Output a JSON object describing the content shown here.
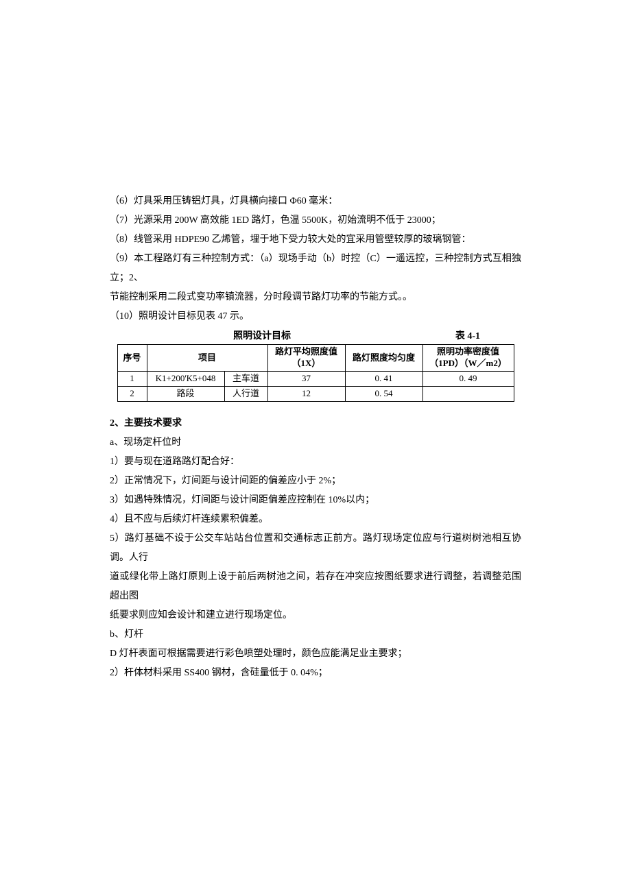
{
  "paras": {
    "p6": "（6）灯具采用压铸铝灯具，灯具横向接口 Φ60 毫米：",
    "p7": "（7）光源采用 200W 高效能 1ED 路灯，色温 5500K，初始流明不低于 23000；",
    "p8": "（8）线管采用 HDPE90 乙烯管，埋于地下受力较大处的宜采用管壁较厚的玻璃钢管：",
    "p9_1": "（9）本工程路灯有三种控制方式：（a）现场手动（b）时控（C）一遥远控，三种控制方式互相独立；2、",
    "p9_2": "节能控制采用二段式变功率镇流器，分时段调节路灯功率的节能方式。。",
    "p10": "（10）照明设计目标见表 47 示。"
  },
  "table": {
    "title": "照明设计目标",
    "number": "表 4-1",
    "headers": {
      "seq": "序号",
      "project": "项目",
      "avg_label": "路灯平均照度值",
      "avg_unit": "（1X）",
      "uniformity": "路灯照度均匀度",
      "power_label": "照明功率密度值",
      "power_unit": "（1PD）（W／m2）"
    },
    "rows": [
      {
        "seq": "1",
        "proj_a": "K1+200'K5+048",
        "proj_b": "主车道",
        "avg": "37",
        "uni": "0. 41",
        "pow": "0. 49"
      },
      {
        "seq": "2",
        "proj_a": "路段",
        "proj_b": "人行道",
        "avg": "12",
        "uni": "0. 54",
        "pow": ""
      }
    ]
  },
  "chart_data": {
    "type": "table",
    "title": "照明设计目标",
    "columns": [
      "序号",
      "项目",
      "",
      "路灯平均照度值（1X）",
      "路灯照度均匀度",
      "照明功率密度值（1PD）（W／m2）"
    ],
    "rows": [
      [
        "1",
        "K1+200'K5+048",
        "主车道",
        37,
        0.41,
        0.49
      ],
      [
        "2",
        "路段",
        "人行道",
        12,
        0.54,
        null
      ]
    ]
  },
  "section2": {
    "heading": "2、主要技术要求",
    "a_label": "a、现场定杆位时",
    "a1": "1）要与现在道路路灯配合好：",
    "a2": "2）正常情况下，灯间距与设计间距的偏差应小于 2%；",
    "a3": "3）如遇特殊情况，灯间距与设计间距偏差应控制在 10%以内；",
    "a4": "4）且不应与后续灯杆连续累积偏差。",
    "a5_1": "5）路灯基础不设于公交车站站台位置和交通标志正前方。路灯现场定位应与行道树树池相互协调。人行",
    "a5_2": "道或绿化带上路灯原则上设于前后两树池之间，若存在冲突应按图纸要求进行调整，若调整范围超出图",
    "a5_3": "纸要求则应知会设计和建立进行现场定位。",
    "b_label": "b、灯杆",
    "b1": "D 灯杆表面可根据需要进行彩色喷塑处理时，颜色应能满足业主要求；",
    "b2": "2）杆体材料采用 SS400 钢材，含硅量低于 0. 04%；"
  }
}
